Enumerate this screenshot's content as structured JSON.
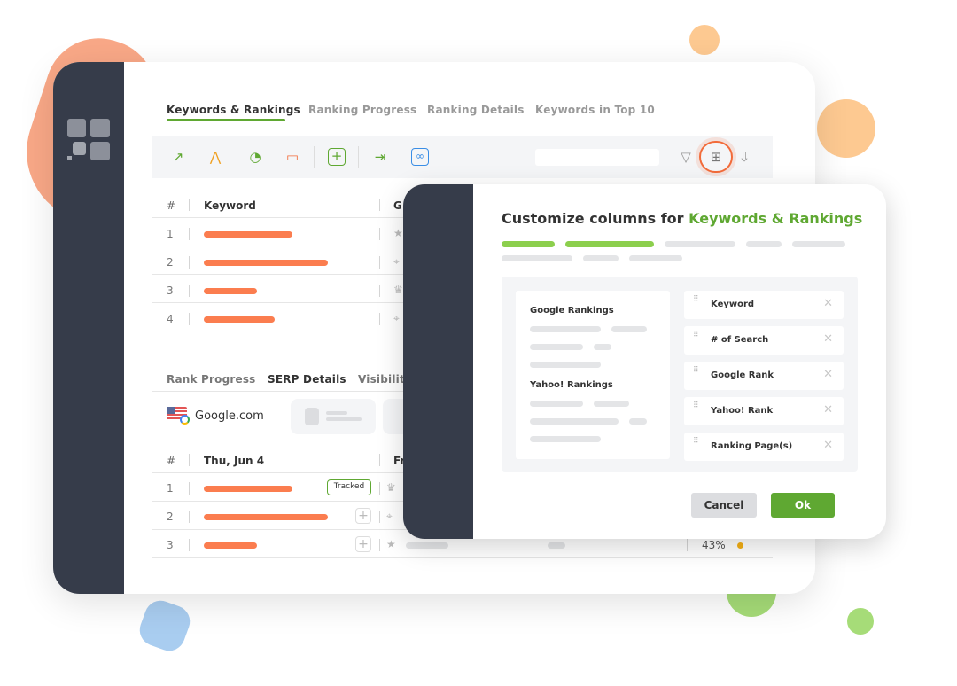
{
  "colors": {
    "accent_green": "#5fa832",
    "bar_orange": "#fb7d4f",
    "sidebar": "#363c4a",
    "highlight": "#f26b3a"
  },
  "tabs": [
    {
      "label": "Keywords & Rankings",
      "active": true
    },
    {
      "label": "Ranking Progress"
    },
    {
      "label": "Ranking Details"
    },
    {
      "label": "Keywords in Top 10"
    }
  ],
  "toolbar": {
    "icons": [
      "trend-refresh-icon",
      "ads-refresh-icon",
      "speed-refresh-icon",
      "calendar-alert-icon",
      "add-icon",
      "import-icon",
      "link-icon"
    ],
    "right_icons": [
      "filter-icon",
      "columns-icon",
      "export-icon"
    ]
  },
  "table": {
    "headers": [
      "#",
      "Keyword",
      "G"
    ],
    "rows": [
      {
        "n": "1",
        "icon": "★"
      },
      {
        "n": "2",
        "icon": "⌖"
      },
      {
        "n": "3",
        "icon": "♛"
      },
      {
        "n": "4",
        "icon": "⌖"
      }
    ]
  },
  "subtabs": [
    {
      "label": "Rank Progress"
    },
    {
      "label": "SERP Details",
      "active": true
    },
    {
      "label": "Visibility"
    }
  ],
  "engine": "Google.com",
  "serp": {
    "headers": [
      "#",
      "Thu, Jun 4",
      "Fr"
    ],
    "rows": [
      {
        "n": "1",
        "badge": "Tracked",
        "icon": "♛"
      },
      {
        "n": "2",
        "icon": "⌖"
      },
      {
        "n": "3",
        "icon": "★",
        "percent": "43%"
      }
    ]
  },
  "modal": {
    "title_prefix": "Customize columns for ",
    "title_highlight": "Keywords & Rankings",
    "group1": "Google Rankings",
    "group2": "Yahoo! Rankings",
    "columns": [
      "Keyword",
      "# of Search",
      "Google Rank",
      "Yahoo! Rank",
      "Ranking Page(s)"
    ],
    "cancel": "Cancel",
    "ok": "Ok"
  }
}
